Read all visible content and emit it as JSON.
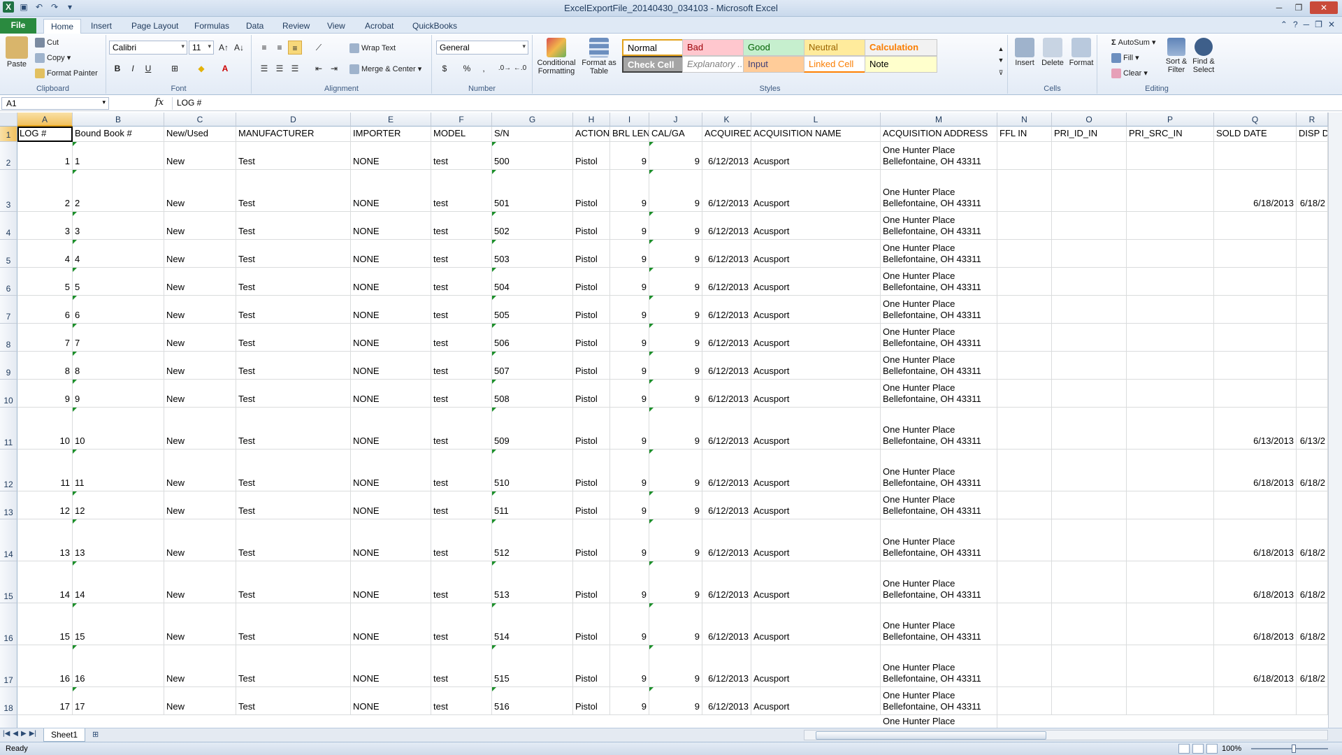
{
  "window": {
    "title": "ExcelExportFile_20140430_034103  -  Microsoft Excel"
  },
  "tabs": [
    "File",
    "Home",
    "Insert",
    "Page Layout",
    "Formulas",
    "Data",
    "Review",
    "View",
    "Acrobat",
    "QuickBooks"
  ],
  "ribbon": {
    "clipboard": {
      "paste": "Paste",
      "cut": "Cut",
      "copy": "Copy",
      "format_painter": "Format Painter",
      "label": "Clipboard"
    },
    "font": {
      "name": "Calibri",
      "size": "11",
      "label": "Font",
      "bold": "B",
      "italic": "I",
      "underline": "U"
    },
    "alignment": {
      "wrap_text": "Wrap Text",
      "merge_center": "Merge & Center",
      "label": "Alignment"
    },
    "number": {
      "format": "General",
      "currency": "$",
      "percent": "%",
      "comma": ",",
      "label": "Number"
    },
    "styles": {
      "conditional": "Conditional Formatting",
      "format_table": "Format as Table",
      "cells": [
        {
          "name": "Normal",
          "bg": "#ffffff",
          "fg": "#000000"
        },
        {
          "name": "Bad",
          "bg": "#ffc7ce",
          "fg": "#9c0006"
        },
        {
          "name": "Good",
          "bg": "#c6efce",
          "fg": "#006100"
        },
        {
          "name": "Neutral",
          "bg": "#ffeb9c",
          "fg": "#9c6500"
        },
        {
          "name": "Calculation",
          "bg": "#f2f2f2",
          "fg": "#fa7d00"
        },
        {
          "name": "Check Cell",
          "bg": "#a5a5a5",
          "fg": "#ffffff"
        },
        {
          "name": "Explanatory ...",
          "bg": "#ffffff",
          "fg": "#7f7f7f"
        },
        {
          "name": "Input",
          "bg": "#ffcc99",
          "fg": "#3f3f76"
        },
        {
          "name": "Linked Cell",
          "bg": "#ffffff",
          "fg": "#fa7d00"
        },
        {
          "name": "Note",
          "bg": "#ffffcc",
          "fg": "#000000"
        }
      ],
      "label": "Styles"
    },
    "cells": {
      "insert": "Insert",
      "delete": "Delete",
      "format": "Format",
      "label": "Cells"
    },
    "editing": {
      "autosum": "AutoSum",
      "fill": "Fill",
      "clear": "Clear",
      "sort_filter": "Sort & Filter",
      "find_select": "Find & Select",
      "label": "Editing"
    }
  },
  "formula_bar": {
    "name_box": "A1",
    "fx": "fx",
    "content": "LOG #"
  },
  "columns": [
    "A",
    "B",
    "C",
    "D",
    "E",
    "F",
    "G",
    "H",
    "I",
    "J",
    "K",
    "L",
    "M",
    "N",
    "O",
    "P",
    "Q",
    "R"
  ],
  "headers": [
    "LOG #",
    "Bound Book #",
    "New/Used",
    "MANUFACTURER",
    "IMPORTER",
    "MODEL",
    "S/N",
    "ACTION",
    "BRL LEN",
    "CAL/GA",
    "ACQUIRED",
    "ACQUISITION NAME",
    "ACQUISITION ADDRESS",
    "FFL IN",
    "PRI_ID_IN",
    "PRI_SRC_IN",
    "SOLD DATE",
    "DISP D"
  ],
  "address_line1": "One Hunter Place",
  "address_line2": "Bellefontaine, OH 43311",
  "rows": [
    {
      "n": "2",
      "log": "1",
      "book": "1",
      "nu": "New",
      "mfr": "Test",
      "imp": "NONE",
      "model": "test",
      "sn": "500",
      "action": "Pistol",
      "brl": "9",
      "cal": "9",
      "acq": "6/12/2013",
      "acqname": "Acusport",
      "sold": "",
      "disp": ""
    },
    {
      "n": "3",
      "log": "2",
      "book": "2",
      "nu": "New",
      "mfr": "Test",
      "imp": "NONE",
      "model": "test",
      "sn": "501",
      "action": "Pistol",
      "brl": "9",
      "cal": "9",
      "acq": "6/12/2013",
      "acqname": "Acusport",
      "sold": "6/18/2013",
      "disp": "6/18/2"
    },
    {
      "n": "4",
      "log": "3",
      "book": "3",
      "nu": "New",
      "mfr": "Test",
      "imp": "NONE",
      "model": "test",
      "sn": "502",
      "action": "Pistol",
      "brl": "9",
      "cal": "9",
      "acq": "6/12/2013",
      "acqname": "Acusport",
      "sold": "",
      "disp": ""
    },
    {
      "n": "5",
      "log": "4",
      "book": "4",
      "nu": "New",
      "mfr": "Test",
      "imp": "NONE",
      "model": "test",
      "sn": "503",
      "action": "Pistol",
      "brl": "9",
      "cal": "9",
      "acq": "6/12/2013",
      "acqname": "Acusport",
      "sold": "",
      "disp": ""
    },
    {
      "n": "6",
      "log": "5",
      "book": "5",
      "nu": "New",
      "mfr": "Test",
      "imp": "NONE",
      "model": "test",
      "sn": "504",
      "action": "Pistol",
      "brl": "9",
      "cal": "9",
      "acq": "6/12/2013",
      "acqname": "Acusport",
      "sold": "",
      "disp": ""
    },
    {
      "n": "7",
      "log": "6",
      "book": "6",
      "nu": "New",
      "mfr": "Test",
      "imp": "NONE",
      "model": "test",
      "sn": "505",
      "action": "Pistol",
      "brl": "9",
      "cal": "9",
      "acq": "6/12/2013",
      "acqname": "Acusport",
      "sold": "",
      "disp": ""
    },
    {
      "n": "8",
      "log": "7",
      "book": "7",
      "nu": "New",
      "mfr": "Test",
      "imp": "NONE",
      "model": "test",
      "sn": "506",
      "action": "Pistol",
      "brl": "9",
      "cal": "9",
      "acq": "6/12/2013",
      "acqname": "Acusport",
      "sold": "",
      "disp": ""
    },
    {
      "n": "9",
      "log": "8",
      "book": "8",
      "nu": "New",
      "mfr": "Test",
      "imp": "NONE",
      "model": "test",
      "sn": "507",
      "action": "Pistol",
      "brl": "9",
      "cal": "9",
      "acq": "6/12/2013",
      "acqname": "Acusport",
      "sold": "",
      "disp": ""
    },
    {
      "n": "10",
      "log": "9",
      "book": "9",
      "nu": "New",
      "mfr": "Test",
      "imp": "NONE",
      "model": "test",
      "sn": "508",
      "action": "Pistol",
      "brl": "9",
      "cal": "9",
      "acq": "6/12/2013",
      "acqname": "Acusport",
      "sold": "",
      "disp": ""
    },
    {
      "n": "11",
      "log": "10",
      "book": "10",
      "nu": "New",
      "mfr": "Test",
      "imp": "NONE",
      "model": "test",
      "sn": "509",
      "action": "Pistol",
      "brl": "9",
      "cal": "9",
      "acq": "6/12/2013",
      "acqname": "Acusport",
      "sold": "6/13/2013",
      "disp": "6/13/2"
    },
    {
      "n": "12",
      "log": "11",
      "book": "11",
      "nu": "New",
      "mfr": "Test",
      "imp": "NONE",
      "model": "test",
      "sn": "510",
      "action": "Pistol",
      "brl": "9",
      "cal": "9",
      "acq": "6/12/2013",
      "acqname": "Acusport",
      "sold": "6/18/2013",
      "disp": "6/18/2"
    },
    {
      "n": "13",
      "log": "12",
      "book": "12",
      "nu": "New",
      "mfr": "Test",
      "imp": "NONE",
      "model": "test",
      "sn": "511",
      "action": "Pistol",
      "brl": "9",
      "cal": "9",
      "acq": "6/12/2013",
      "acqname": "Acusport",
      "sold": "",
      "disp": ""
    },
    {
      "n": "14",
      "log": "13",
      "book": "13",
      "nu": "New",
      "mfr": "Test",
      "imp": "NONE",
      "model": "test",
      "sn": "512",
      "action": "Pistol",
      "brl": "9",
      "cal": "9",
      "acq": "6/12/2013",
      "acqname": "Acusport",
      "sold": "6/18/2013",
      "disp": "6/18/2"
    },
    {
      "n": "15",
      "log": "14",
      "book": "14",
      "nu": "New",
      "mfr": "Test",
      "imp": "NONE",
      "model": "test",
      "sn": "513",
      "action": "Pistol",
      "brl": "9",
      "cal": "9",
      "acq": "6/12/2013",
      "acqname": "Acusport",
      "sold": "6/18/2013",
      "disp": "6/18/2"
    },
    {
      "n": "16",
      "log": "15",
      "book": "15",
      "nu": "New",
      "mfr": "Test",
      "imp": "NONE",
      "model": "test",
      "sn": "514",
      "action": "Pistol",
      "brl": "9",
      "cal": "9",
      "acq": "6/12/2013",
      "acqname": "Acusport",
      "sold": "6/18/2013",
      "disp": "6/18/2"
    },
    {
      "n": "17",
      "log": "16",
      "book": "16",
      "nu": "New",
      "mfr": "Test",
      "imp": "NONE",
      "model": "test",
      "sn": "515",
      "action": "Pistol",
      "brl": "9",
      "cal": "9",
      "acq": "6/12/2013",
      "acqname": "Acusport",
      "sold": "6/18/2013",
      "disp": "6/18/2"
    },
    {
      "n": "18",
      "log": "17",
      "book": "17",
      "nu": "New",
      "mfr": "Test",
      "imp": "NONE",
      "model": "test",
      "sn": "516",
      "action": "Pistol",
      "brl": "9",
      "cal": "9",
      "acq": "6/12/2013",
      "acqname": "Acusport",
      "sold": "",
      "disp": ""
    }
  ],
  "partial_row_text": "One Hunter Place",
  "sheet": {
    "tab": "Sheet1"
  },
  "status": {
    "ready": "Ready",
    "zoom": "100%"
  }
}
